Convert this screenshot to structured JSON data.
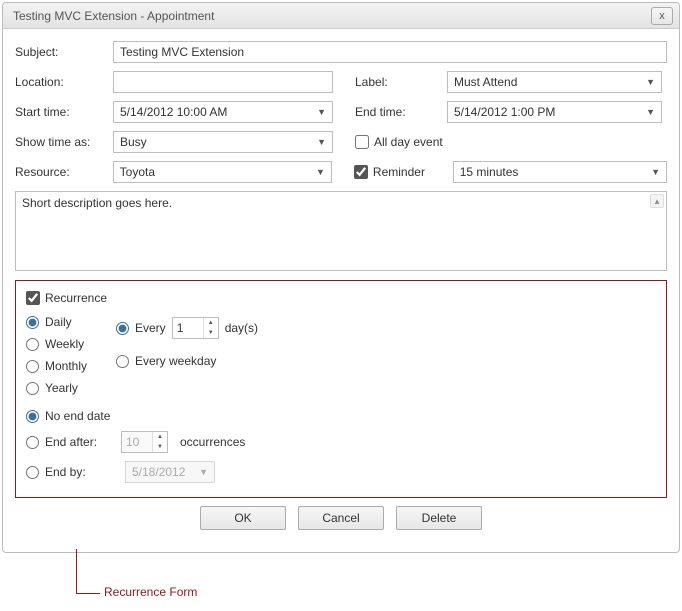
{
  "window": {
    "title": "Testing MVC Extension - Appointment",
    "close_label": "x"
  },
  "form": {
    "subject_label": "Subject:",
    "subject_value": "Testing MVC Extension",
    "location_label": "Location:",
    "location_value": "",
    "label_label": "Label:",
    "label_value": "Must Attend",
    "start_label": "Start time:",
    "start_value": "5/14/2012 10:00 AM",
    "end_label": "End time:",
    "end_value": "5/14/2012 1:00 PM",
    "showas_label": "Show time as:",
    "showas_value": "Busy",
    "allday_label": "All day event",
    "allday_checked": false,
    "resource_label": "Resource:",
    "resource_value": "Toyota",
    "reminder_label": "Reminder",
    "reminder_checked": true,
    "reminder_value": "15 minutes",
    "description_value": "Short description goes here."
  },
  "recurrence": {
    "header_label": "Recurrence",
    "header_checked": true,
    "freq": {
      "daily": "Daily",
      "weekly": "Weekly",
      "monthly": "Monthly",
      "yearly": "Yearly",
      "selected": "daily"
    },
    "daily": {
      "every_label": "Every",
      "every_value": "1",
      "days_label": "day(s)",
      "weekday_label": "Every weekday",
      "selected": "every"
    },
    "end": {
      "noend_label": "No end date",
      "endafter_label": "End after:",
      "endafter_value": "10",
      "occurrences_label": "occurrences",
      "endby_label": "End by:",
      "endby_value": "5/18/2012",
      "selected": "noend"
    }
  },
  "buttons": {
    "ok": "OK",
    "cancel": "Cancel",
    "delete": "Delete"
  },
  "annotation": {
    "label": "Recurrence Form"
  }
}
